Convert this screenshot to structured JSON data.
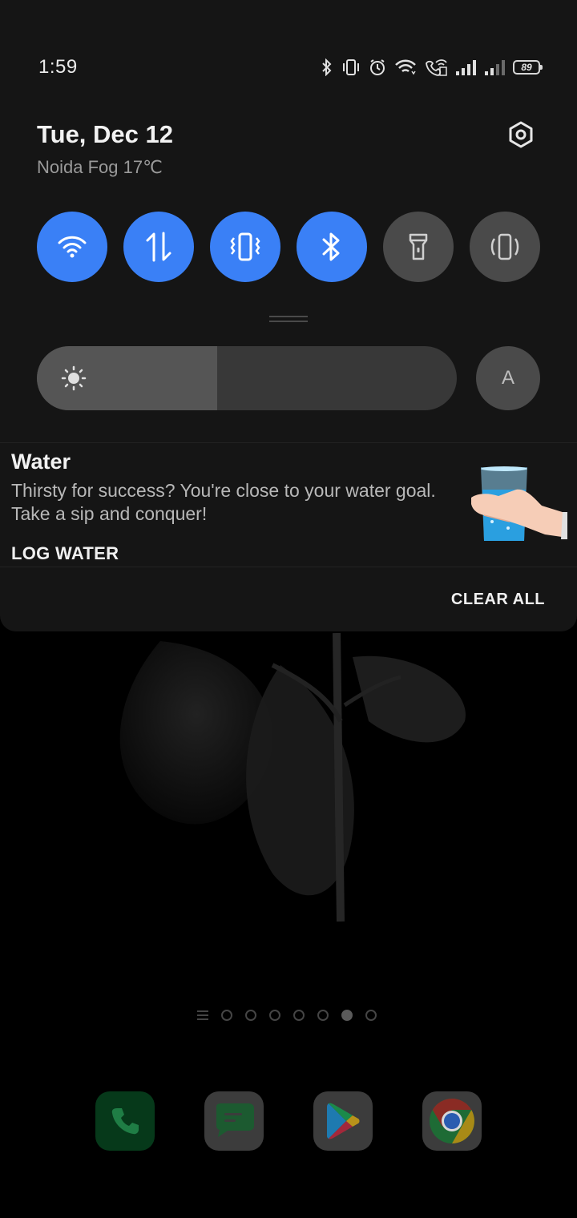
{
  "status_bar": {
    "time": "1:59",
    "battery_level": "89",
    "icons": [
      "bluetooth-icon",
      "vibrate-icon",
      "alarm-icon",
      "wifi-icon",
      "wifi-calling-icon",
      "signal-icon",
      "signal-icon"
    ]
  },
  "header": {
    "date": "Tue, Dec 12",
    "weather": "Noida Fog 17℃"
  },
  "quick_tiles": [
    {
      "name": "wifi",
      "icon": "wifi-icon",
      "state": "on"
    },
    {
      "name": "mobile-data",
      "icon": "data-arrows-icon",
      "state": "on"
    },
    {
      "name": "vibrate",
      "icon": "vibrate-icon",
      "state": "on"
    },
    {
      "name": "bluetooth",
      "icon": "bluetooth-icon",
      "state": "on"
    },
    {
      "name": "flashlight",
      "icon": "flashlight-icon",
      "state": "off"
    },
    {
      "name": "auto-rotate",
      "icon": "rotate-icon",
      "state": "off"
    }
  ],
  "brightness": {
    "level_percent": 43,
    "auto_label": "A"
  },
  "notification": {
    "title": "Water",
    "body": "Thirsty for success? You're close to your water goal. Take a sip and conquer!",
    "action": "LOG WATER"
  },
  "clear_all_label": "CLEAR ALL",
  "home": {
    "page_count": 7,
    "active_page": 5,
    "dock_apps": [
      "phone",
      "messages",
      "play-store",
      "chrome"
    ]
  },
  "colors": {
    "tile_on": "#3a80f6",
    "tile_off": "#4a4a4a",
    "panel_bg": "#151515"
  }
}
